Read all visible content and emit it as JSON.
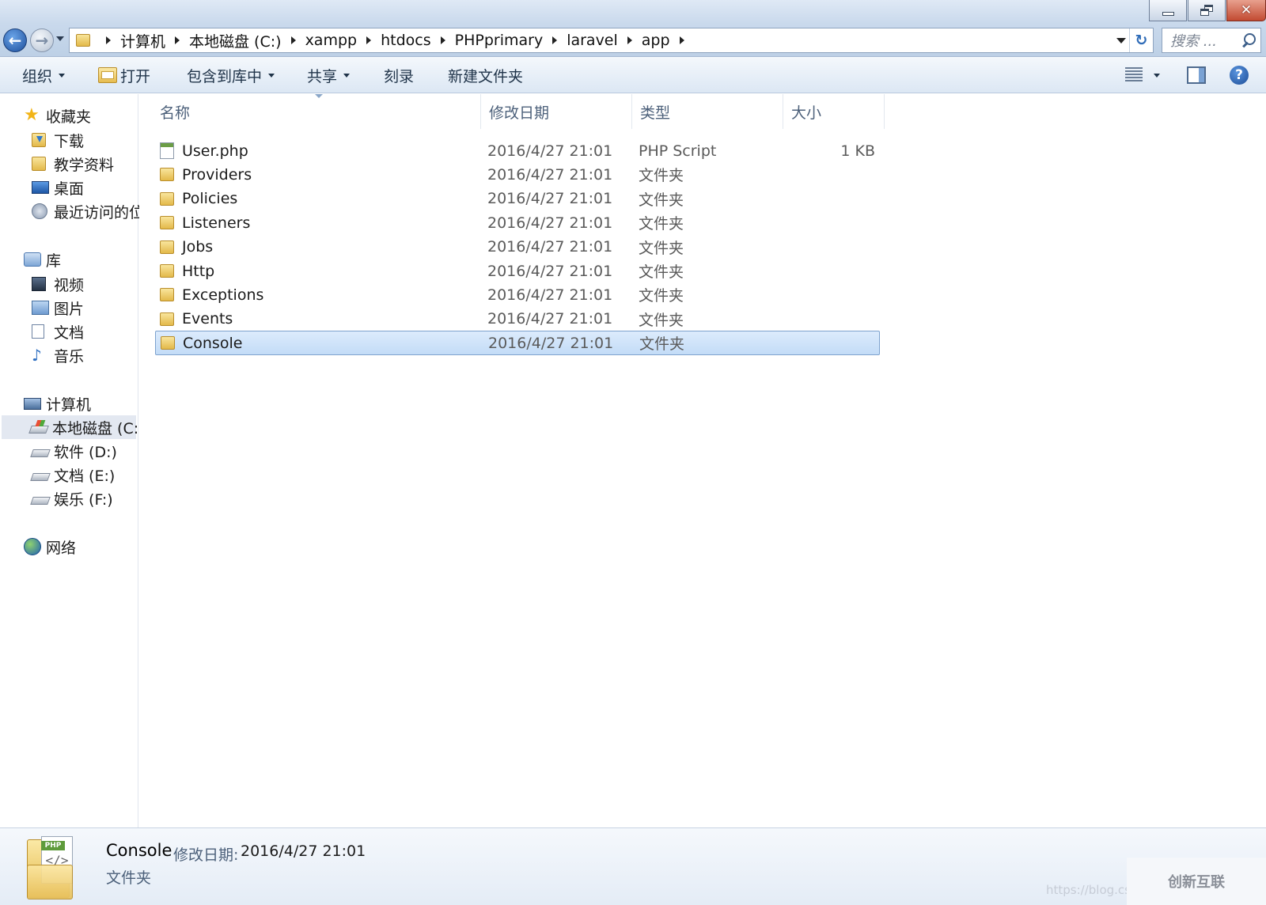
{
  "window": {
    "minimize_label": "—",
    "close_label": "✕"
  },
  "address": {
    "crumbs": [
      "计算机",
      "本地磁盘 (C:)",
      "xampp",
      "htdocs",
      "PHPprimary",
      "laravel",
      "app"
    ],
    "refresh_label": "↻"
  },
  "search": {
    "placeholder": "搜索 ..."
  },
  "toolbar": {
    "organize": "组织",
    "open": "打开",
    "include_in_library": "包含到库中",
    "share": "共享",
    "burn": "刻录",
    "new_folder": "新建文件夹",
    "help_label": "?"
  },
  "sidebar": {
    "favorites": {
      "label": "收藏夹",
      "items": [
        {
          "label": "下载",
          "icon": "download-folder-icon"
        },
        {
          "label": "教学资料",
          "icon": "folder-icon"
        },
        {
          "label": "桌面",
          "icon": "desktop-icon"
        },
        {
          "label": "最近访问的位",
          "icon": "recent-places-icon"
        }
      ]
    },
    "libraries": {
      "label": "库",
      "items": [
        {
          "label": "视频",
          "icon": "videos-icon"
        },
        {
          "label": "图片",
          "icon": "pictures-icon"
        },
        {
          "label": "文档",
          "icon": "documents-icon"
        },
        {
          "label": "音乐",
          "icon": "music-icon"
        }
      ]
    },
    "computer": {
      "label": "计算机",
      "items": [
        {
          "label": "本地磁盘 (C:)",
          "icon": "system-drive-icon",
          "selected": true
        },
        {
          "label": "软件 (D:)",
          "icon": "drive-icon"
        },
        {
          "label": "文档 (E:)",
          "icon": "drive-icon"
        },
        {
          "label": "娱乐 (F:)",
          "icon": "drive-icon"
        }
      ]
    },
    "network": {
      "label": "网络"
    }
  },
  "columns": {
    "name": "名称",
    "modified": "修改日期",
    "type": "类型",
    "size": "大小"
  },
  "files": [
    {
      "name": "User.php",
      "modified": "2016/4/27 21:01",
      "type": "PHP Script",
      "size": "1 KB",
      "kind": "php"
    },
    {
      "name": "Providers",
      "modified": "2016/4/27 21:01",
      "type": "文件夹",
      "size": "",
      "kind": "folder"
    },
    {
      "name": "Policies",
      "modified": "2016/4/27 21:01",
      "type": "文件夹",
      "size": "",
      "kind": "folder"
    },
    {
      "name": "Listeners",
      "modified": "2016/4/27 21:01",
      "type": "文件夹",
      "size": "",
      "kind": "folder"
    },
    {
      "name": "Jobs",
      "modified": "2016/4/27 21:01",
      "type": "文件夹",
      "size": "",
      "kind": "folder"
    },
    {
      "name": "Http",
      "modified": "2016/4/27 21:01",
      "type": "文件夹",
      "size": "",
      "kind": "folder"
    },
    {
      "name": "Exceptions",
      "modified": "2016/4/27 21:01",
      "type": "文件夹",
      "size": "",
      "kind": "folder"
    },
    {
      "name": "Events",
      "modified": "2016/4/27 21:01",
      "type": "文件夹",
      "size": "",
      "kind": "folder"
    },
    {
      "name": "Console",
      "modified": "2016/4/27 21:01",
      "type": "文件夹",
      "size": "",
      "kind": "folder",
      "selected": true
    }
  ],
  "details": {
    "name": "Console",
    "modified_label": "修改日期:",
    "modified": "2016/4/27 21:01",
    "type": "文件夹",
    "icon_tag": "PHP",
    "icon_glyph": "</>"
  },
  "watermark": {
    "url": "https://blog.csdn.ne",
    "brand": "创新互联"
  },
  "colors": {
    "selection_fill": "#cce4fb",
    "selection_border": "#7da2ce",
    "accent": "#2f6cb8"
  }
}
